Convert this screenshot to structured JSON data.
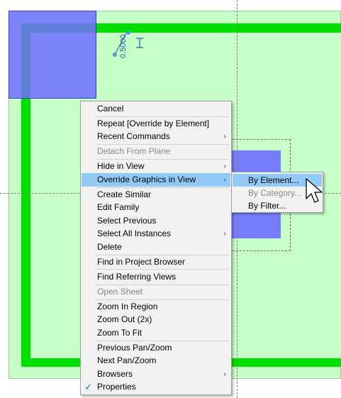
{
  "dimension": {
    "value": "0.5000"
  },
  "context_menu": {
    "items": [
      {
        "label": "Cancel"
      },
      {
        "label": "Repeat [Override by Element]"
      },
      {
        "label": "Recent Commands",
        "submenu": true
      },
      {
        "label": "Detach From Plane",
        "disabled": true
      },
      {
        "label": "Hide in View",
        "submenu": true
      },
      {
        "label": "Override Graphics in View",
        "submenu": true,
        "highlighted": true
      },
      {
        "label": "Create Similar"
      },
      {
        "label": "Edit Family"
      },
      {
        "label": "Select Previous"
      },
      {
        "label": "Select All Instances",
        "submenu": true
      },
      {
        "label": "Delete"
      },
      {
        "label": "Find in Project Browser"
      },
      {
        "label": "Find Referring Views"
      },
      {
        "label": "Open Sheet",
        "disabled": true
      },
      {
        "label": "Zoom In Region"
      },
      {
        "label": "Zoom Out (2x)"
      },
      {
        "label": "Zoom To Fit"
      },
      {
        "label": "Previous Pan/Zoom"
      },
      {
        "label": "Next Pan/Zoom"
      },
      {
        "label": "Browsers",
        "submenu": true
      },
      {
        "label": "Properties",
        "checked": true
      }
    ],
    "submenu_arrow": "›",
    "check_mark": "✓"
  },
  "override_submenu": {
    "items": [
      {
        "label": "By Element...",
        "highlighted": true
      },
      {
        "label": "By Category...",
        "disabled": true
      },
      {
        "label": "By Filter..."
      }
    ]
  },
  "colors": {
    "floor": "#c8ffc8",
    "wall": "#00e000",
    "selection_blue": "#6e6eff",
    "menu_highlight": "#91c9f7"
  }
}
